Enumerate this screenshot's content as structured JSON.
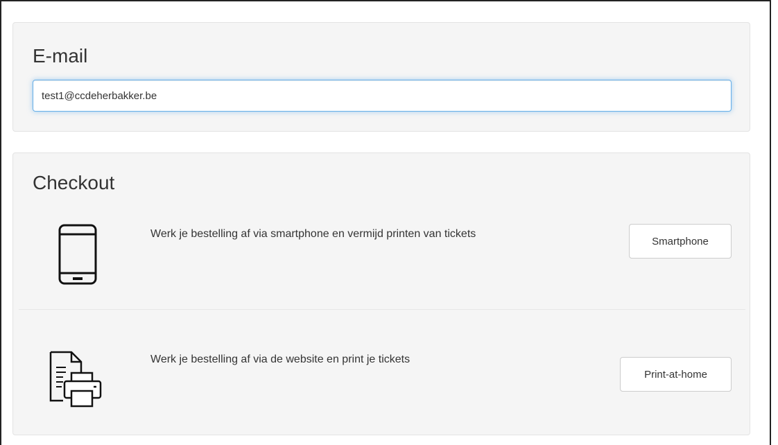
{
  "email": {
    "title": "E-mail",
    "value": "test1@ccdeherbakker.be"
  },
  "checkout": {
    "title": "Checkout",
    "options": [
      {
        "icon": "smartphone-icon",
        "text": "Werk je bestelling af via smartphone en vermijd printen van tickets",
        "button_label": "Smartphone"
      },
      {
        "icon": "print-document-icon",
        "text": "Werk je bestelling af via de website en print je tickets",
        "button_label": "Print-at-home"
      }
    ]
  },
  "colors": {
    "panel_background": "#f5f5f5",
    "input_focus_border": "#66afe9",
    "text": "#333333"
  }
}
